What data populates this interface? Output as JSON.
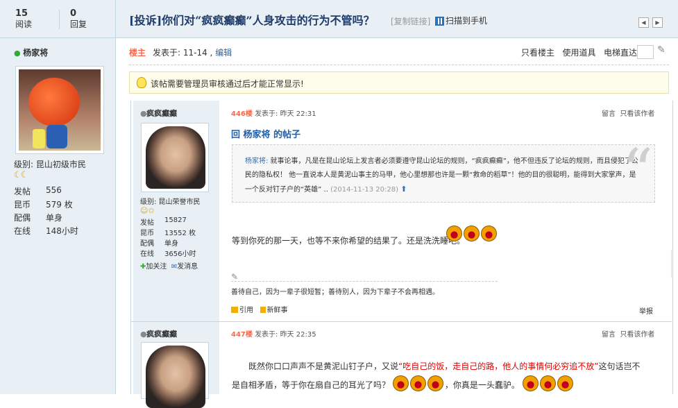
{
  "header": {
    "views_count": "15",
    "views_label": "阅读",
    "replies_count": "0",
    "replies_label": "回复",
    "title_prefix": "[投诉]",
    "title": "你们对“疯疯癫癫”人身攻击的行为不管吗？",
    "copy_link": "[复制链接]",
    "scan_to_phone": "扫描到手机",
    "prev_icon": "◀",
    "next_icon": "▶"
  },
  "author": {
    "name": "杨家将",
    "level": "级别: 昆山初级市民",
    "level_icons": "☾☾",
    "stats": [
      {
        "label": "发帖",
        "value": "556"
      },
      {
        "label": "昆币",
        "value": "579 枚"
      },
      {
        "label": "配偶",
        "value": "单身"
      },
      {
        "label": "在线",
        "value": "148小时"
      }
    ]
  },
  "post_meta": {
    "floor_label": "楼主",
    "posted_at": "发表于: 11-14 ,",
    "edit": "编辑",
    "only_op": "只看楼主",
    "use_tools": "使用道具",
    "elevator": "电梯直达"
  },
  "notice": "该帖需要管理员审核通过后才能正常显示!",
  "replies": [
    {
      "name": "疯疯癫癫",
      "level": "级别: 昆山荣誉市民",
      "level_icons": "☺✩",
      "stats": [
        {
          "label": "发帖",
          "value": "15827"
        },
        {
          "label": "昆币",
          "value": "13552 枚"
        },
        {
          "label": "配偶",
          "value": "单身"
        },
        {
          "label": "在线",
          "value": "3656小时"
        }
      ],
      "follow": "加关注",
      "message": "发消息",
      "floor": "446楼",
      "posted": "发表于: 昨天 22:31",
      "comment": "留言",
      "only_author": "只看该作者",
      "title": "回 杨家将 的帖子",
      "quote_name": "杨家将:",
      "quote_text": " 就事论事，凡是在昆山论坛上发言者必须要遵守昆山论坛的规则，“疯疯癫癫”，他不但违反了论坛的规则，而且侵犯了公民的隐私权！ 他一直说本人是黄泥山事主的马甲，他心里想那也许是一颗“救命的稻草”！他的目的很聪明，能得到大家掌声，是一个反对钉子户的“英雄” ..",
      "quote_time": "(2014-11-13 20:28)",
      "body": "等到你死的那一天，也等不来你希望的结果了。还是洗洗睡吧。",
      "signature": "善待自己，因为一辈子很短暂；善待别人，因为下辈子不会再相遇。",
      "quote_btn": "引用",
      "fresh_btn": "新鲜事",
      "report": "举报"
    },
    {
      "name": "疯疯癫癫",
      "floor": "447楼",
      "posted": "发表于: 昨天 22:35",
      "comment": "留言",
      "only_author": "只看该作者",
      "body_a": "既然你口口声声不是黄泥山钉子户，又说",
      "body_red": "“吃自己的饭，走自己的路，他人的事情何必穷追不放”",
      "body_b": "这句话岂不是自相矛盾，等于你在扇自己的耳光了吗？",
      "body_c": "，你真是一头蠢驴。"
    }
  ]
}
